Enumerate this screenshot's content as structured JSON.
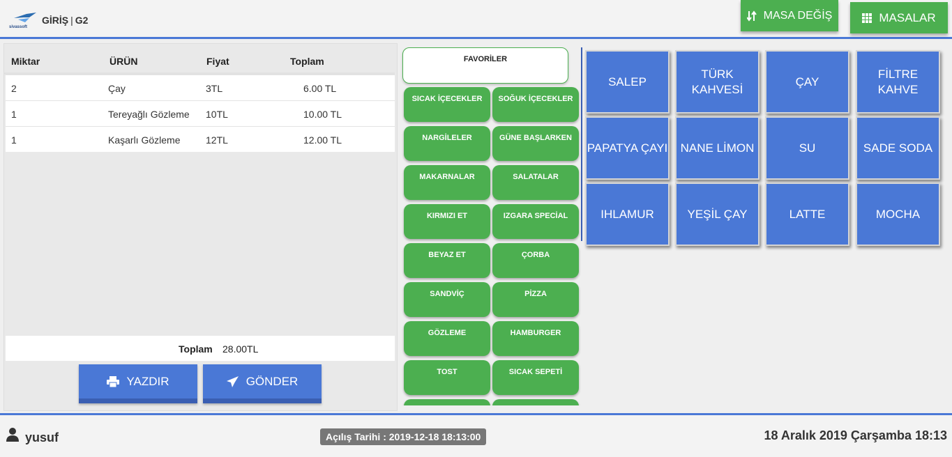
{
  "header": {
    "brand_text": "sivassoft",
    "title": "GİRİŞ",
    "separator": "|",
    "table_name": "G2",
    "masa_degis_label": "MASA DEĞİŞ",
    "masalar_label": "MASALAR"
  },
  "order": {
    "columns": [
      "Miktar",
      "ÜRÜN",
      "Fiyat",
      "Toplam"
    ],
    "rows": [
      {
        "qty": "2",
        "product": "Çay",
        "price": "3TL",
        "total": "6.00 TL"
      },
      {
        "qty": "1",
        "product": "Tereyağlı Gözleme",
        "price": "10TL",
        "total": "10.00 TL"
      },
      {
        "qty": "1",
        "product": "Kaşarlı Gözleme",
        "price": "12TL",
        "total": "12.00 TL"
      }
    ],
    "total_label": "Toplam",
    "total_value": "28.00TL",
    "print_label": "YAZDIR",
    "send_label": "GÖNDER"
  },
  "categories": {
    "favorites": "FAVORİLER",
    "items": [
      "SICAK İÇECEKLER",
      "SOĞUK İÇECEKLER",
      "NARGİLELER",
      "GÜNE BAŞLARKEN",
      "MAKARNALAR",
      "SALATALAR",
      "KIRMIZI ET",
      "IZGARA SPECİAL",
      "BEYAZ ET",
      "ÇORBA",
      "SANDVİÇ",
      "PİZZA",
      "GÖZLEME",
      "HAMBURGER",
      "TOST",
      "SICAK SEPETİ"
    ]
  },
  "products": [
    "SALEP",
    "TÜRK KAHVESİ",
    "ÇAY",
    "FİLTRE KAHVE",
    "PAPATYA ÇAYI",
    "NANE LİMON",
    "SU",
    "SADE SODA",
    "IHLAMUR",
    "YEŞİL ÇAY",
    "LATTE",
    "MOCHA"
  ],
  "footer": {
    "user": "yusuf",
    "opening": "Açılış Tarihi : 2019-12-18 18:13:00",
    "datetime": "18 Aralık 2019 Çarşamba 18:13"
  },
  "colors": {
    "accent_blue": "#4a78d6",
    "accent_green": "#4caf50",
    "badge_gray": "#777777"
  },
  "icons": {
    "masa_degis": "sort-arrows-icon",
    "masalar": "grid-icon",
    "print": "printer-icon",
    "send": "paper-plane-icon",
    "user": "user-icon"
  }
}
